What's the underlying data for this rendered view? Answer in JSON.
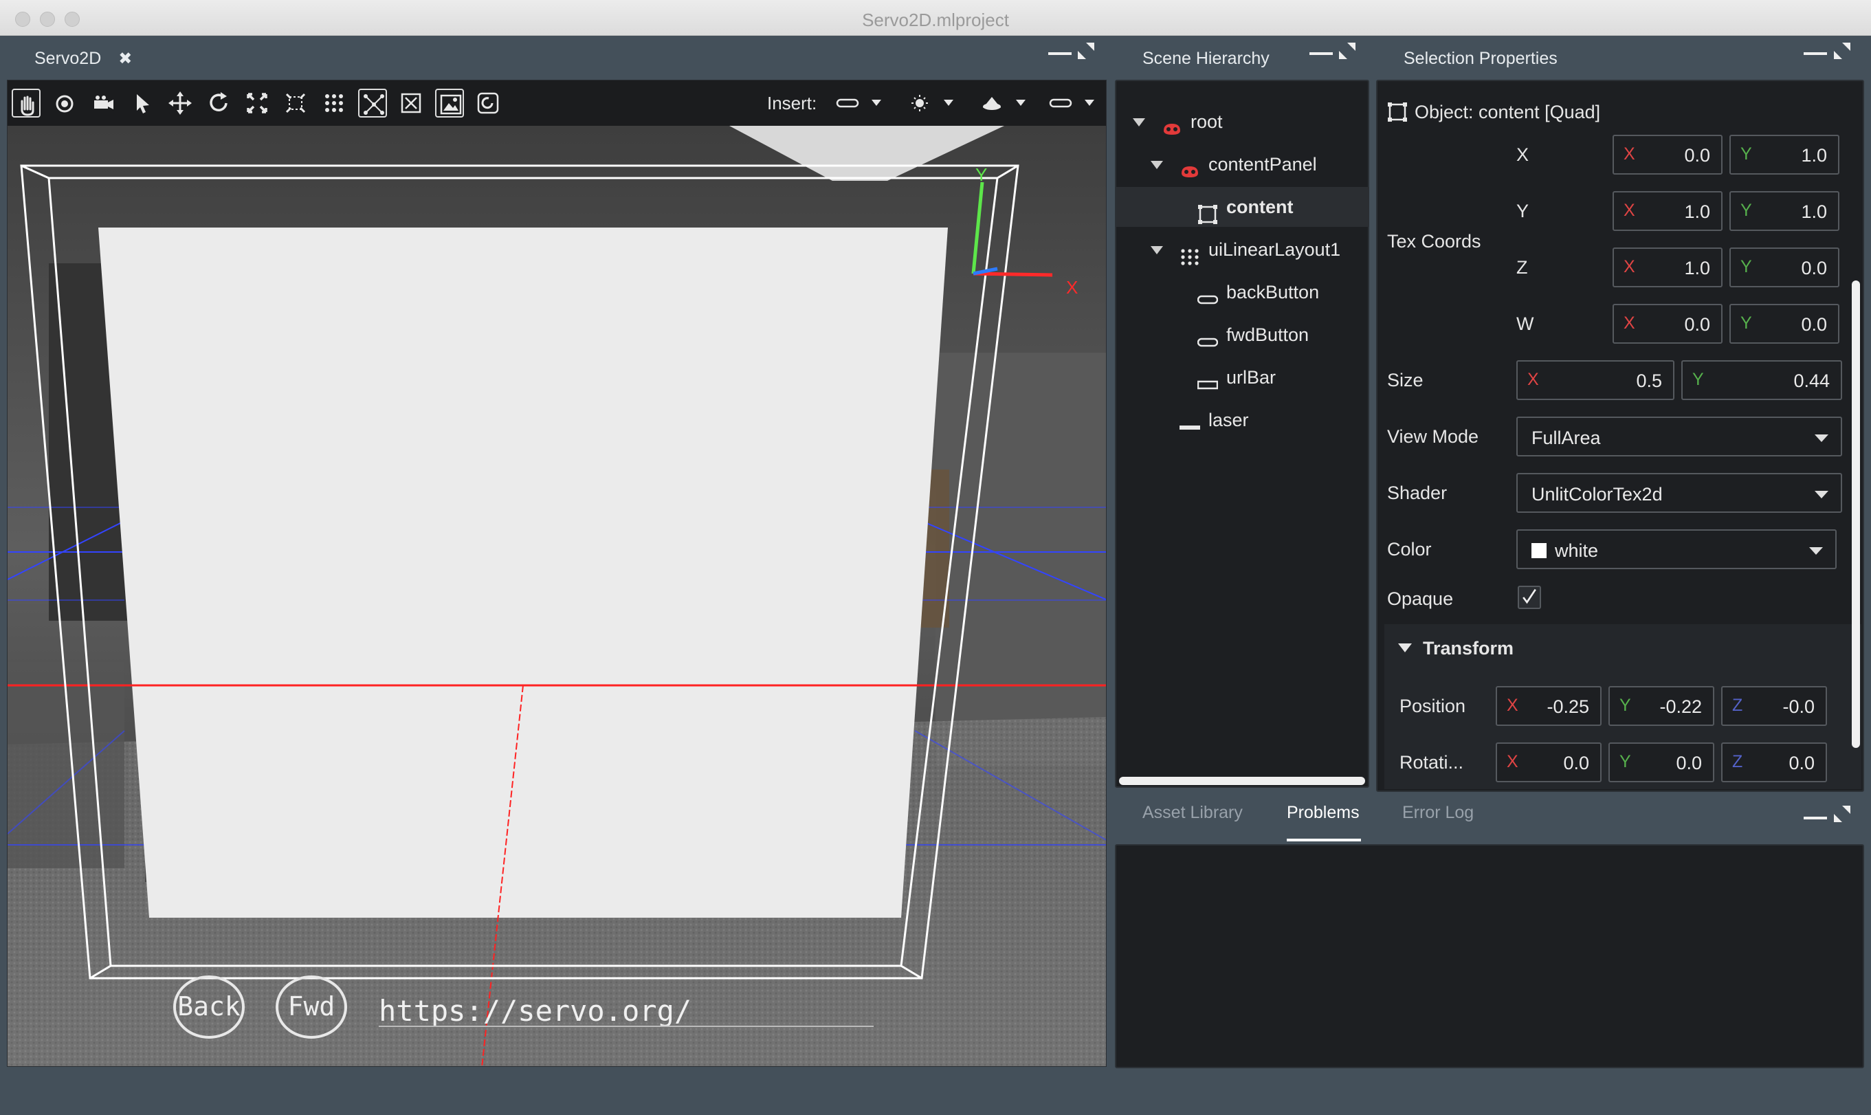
{
  "window": {
    "title": "Servo2D.mlproject"
  },
  "viewport": {
    "tab_label": "Servo2D",
    "close_glyph": "✖",
    "insert_label": "Insert:",
    "tools": [
      "hand-icon",
      "orbit-icon",
      "camera-icon",
      "select-arrow-icon",
      "move-icon",
      "rotate-icon",
      "scale-icon",
      "snap-icon",
      "grid-icon",
      "bounds-icon",
      "close-box-icon",
      "image-icon",
      "reset-icon"
    ],
    "scene": {
      "back_label": "Back",
      "fwd_label": "Fwd",
      "url_text": "https://servo.org/",
      "gizmo_x": "X",
      "gizmo_y": "Y"
    }
  },
  "hierarchy": {
    "title": "Scene Hierarchy",
    "items": [
      {
        "label": "root",
        "icon": "mask-icon",
        "expanded": true,
        "depth": 0
      },
      {
        "label": "contentPanel",
        "icon": "mask-icon",
        "expanded": true,
        "depth": 1
      },
      {
        "label": "content",
        "icon": "quad-icon",
        "selected": true,
        "depth": 2
      },
      {
        "label": "uiLinearLayout1",
        "icon": "grid-dots-icon",
        "expanded": true,
        "depth": 1
      },
      {
        "label": "backButton",
        "icon": "button-icon",
        "depth": 2
      },
      {
        "label": "fwdButton",
        "icon": "button-icon",
        "depth": 2
      },
      {
        "label": "urlBar",
        "icon": "textbox-icon",
        "depth": 2
      },
      {
        "label": "laser",
        "icon": "line-icon",
        "depth": 1
      }
    ]
  },
  "properties": {
    "title": "Selection Properties",
    "object_label": "Object: content [Quad]",
    "tex_coords_label": "Tex Coords",
    "tex_rows": [
      {
        "row": "X",
        "x": "0.0",
        "y": "1.0"
      },
      {
        "row": "Y",
        "x": "1.0",
        "y": "1.0"
      },
      {
        "row": "Z",
        "x": "1.0",
        "y": "0.0"
      },
      {
        "row": "W",
        "x": "0.0",
        "y": "0.0"
      }
    ],
    "size_label": "Size",
    "size": {
      "x": "0.5",
      "y": "0.44"
    },
    "view_mode_label": "View Mode",
    "view_mode": "FullArea",
    "shader_label": "Shader",
    "shader": "UnlitColorTex2d",
    "color_label": "Color",
    "color": "white",
    "opaque_label": "Opaque",
    "opaque": true,
    "transform_label": "Transform",
    "position_label": "Position",
    "position": {
      "x": "-0.25",
      "y": "-0.22",
      "z": "-0.0"
    },
    "rotation_label": "Rotati...",
    "rotation": {
      "x": "0.0",
      "y": "0.0",
      "z": "0.0"
    },
    "axis_labels": {
      "x": "X",
      "y": "Y",
      "z": "Z"
    }
  },
  "bottom": {
    "tabs": [
      "Asset Library",
      "Problems",
      "Error Log"
    ],
    "active_tab": "Problems"
  },
  "colors": {
    "background": "#44505a",
    "panel": "#1d1f22",
    "axis_x": "#e04444",
    "axis_y": "#56b04c",
    "axis_z": "#5462c8"
  }
}
